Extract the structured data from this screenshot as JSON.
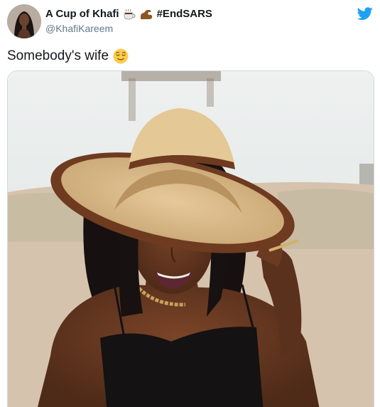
{
  "tweet": {
    "author": {
      "display_name": "A Cup of Khafi",
      "name_emojis": [
        "hot-beverage",
        "flexed-biceps"
      ],
      "hashtag": "#EndSARS",
      "handle": "@KhafiKareem"
    },
    "text": "Somebody's wife",
    "text_emoji": "relieved-face",
    "media_alt": "Woman in a wide-brimmed straw sun hat smiling on a beach",
    "icons": {
      "platform": "twitter-bird-icon"
    },
    "colors": {
      "twitter_blue": "#1da1f2",
      "text_primary": "#14171a",
      "text_secondary": "#657786"
    }
  }
}
